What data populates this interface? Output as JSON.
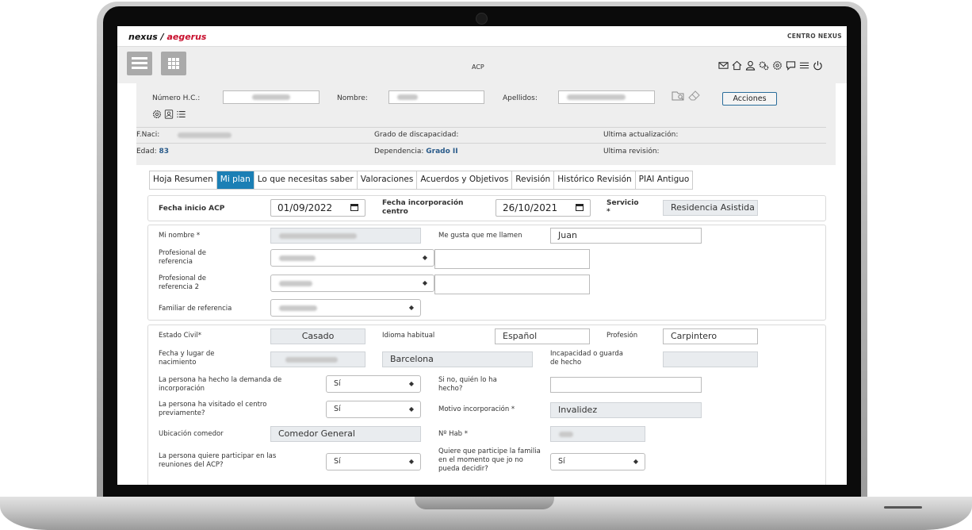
{
  "header": {
    "brand_left": "nexus",
    "brand_sep": " / ",
    "brand_right": "aegerus",
    "center_name": "CENTRO NEXUS",
    "page_title": "ACP",
    "icons": [
      "mail-icon",
      "home-icon",
      "user-icon",
      "gears-icon",
      "network-icon",
      "chat-icon",
      "list-icon",
      "power-icon"
    ]
  },
  "patient": {
    "hc_label": "Número H.C.:",
    "name_label": "Nombre:",
    "surname_label": "Apellidos:",
    "actions_label": "Acciones",
    "birth_label": "F.Naci:",
    "age_label": "Edad:",
    "age_value": "83",
    "disability_label": "Grado de discapacidad:",
    "dependency_label": "Dependencia:",
    "dependency_value": "Grado II",
    "last_update_label": "Ultima actualización:",
    "last_review_label": "Ultima revisión:"
  },
  "tabs": [
    {
      "label": "Hoja Resumen",
      "active": false
    },
    {
      "label": "Mi plan",
      "active": true
    },
    {
      "label": "Lo que necesitas saber",
      "active": false
    },
    {
      "label": "Valoraciones",
      "active": false
    },
    {
      "label": "Acuerdos y Objetivos",
      "active": false
    },
    {
      "label": "Revisión",
      "active": false
    },
    {
      "label": "Histórico Revisión",
      "active": false
    },
    {
      "label": "PIAI Antiguo",
      "active": false
    }
  ],
  "form": {
    "start_date_label": "Fecha inicio ACP",
    "start_date_value": "01/09/2022",
    "incorporation_date_label": "Fecha incorporación centro",
    "incorporation_date_value": "26/10/2021",
    "service_label": "Servicio",
    "service_required": "*",
    "service_value": "Residencia Asistida",
    "my_name_label": "Mi nombre *",
    "liked_name_label": "Me gusta que me llamen",
    "liked_name_value": "Juan",
    "ref_professional_label": "Profesional de referencia",
    "ref_professional2_label": "Profesional de referencia 2",
    "ref_family_label": "Familiar de referencia",
    "civil_status_label": "Estado Civil*",
    "civil_status_value": "Casado",
    "language_label": "Idioma habitual",
    "language_value": "Español",
    "profession_label": "Profesión",
    "profession_value": "Carpintero",
    "birth_place_label": "Fecha y lugar de nacimiento",
    "birth_city_value": "Barcelona",
    "incapacity_label": "Incapacidad o guarda de hecho",
    "demand_label": "La persona ha hecho la demanda de incorporación",
    "demand_value": "Sí",
    "who_label": "Si no, quién lo ha hecho?",
    "visited_label": "La persona ha visitado el centro previamente?",
    "visited_value": "Sí",
    "reason_label": "Motivo incorporación *",
    "reason_value": "Invalidez",
    "dining_label": "Ubicación comedor",
    "dining_value": "Comedor General",
    "room_label": "Nº Hab *",
    "meetings_label": "La persona quiere participar en las reuniones del ACP?",
    "meetings_value": "Sí",
    "family_label": "Quiere que participe la familia en el momento que jo no pueda decidir?",
    "family_value": "Sí"
  },
  "colors": {
    "accent": "#1b7fb5",
    "brand_red": "#c8102e",
    "bold_value": "#2a5b8a"
  }
}
